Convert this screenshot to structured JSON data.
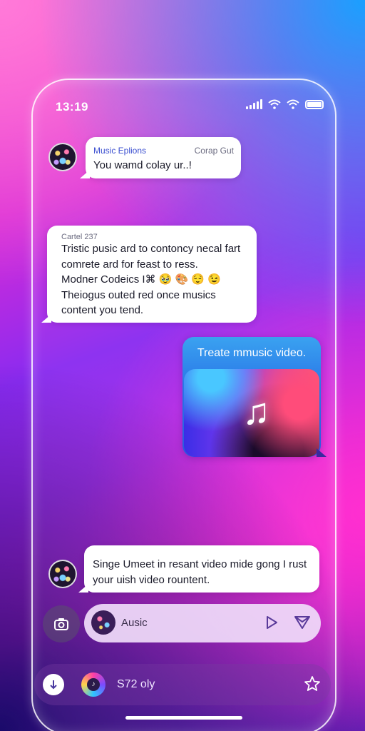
{
  "status_bar": {
    "time": "13:19"
  },
  "messages": [
    {
      "sender": "Music Eplions",
      "meta": "Corap Gut",
      "text": "You wamd colay ur..!"
    },
    {
      "header": "Cartel 237",
      "lines": [
        "Tristic pusic ard to contoncy necal fart",
        "comrete ard for feast to ress.",
        "Modner Codeics I⌘ 🥹 🎨 😌 😉",
        "Theiogus outed red once musics",
        "content you tend."
      ]
    },
    {
      "text": "Treate mmusic video.",
      "media_icon": "music-note-icon"
    },
    {
      "lines": [
        "Singe Umeet in resant video mide gong I rust",
        "your uish video rountent."
      ]
    }
  ],
  "composer": {
    "text": "Ausic"
  },
  "bottom_bar": {
    "text": "S72 oly"
  },
  "colors": {
    "accent_blue": "#2a78e8",
    "bubble": "#ffffff",
    "sender_blue": "#3b4fd0"
  }
}
